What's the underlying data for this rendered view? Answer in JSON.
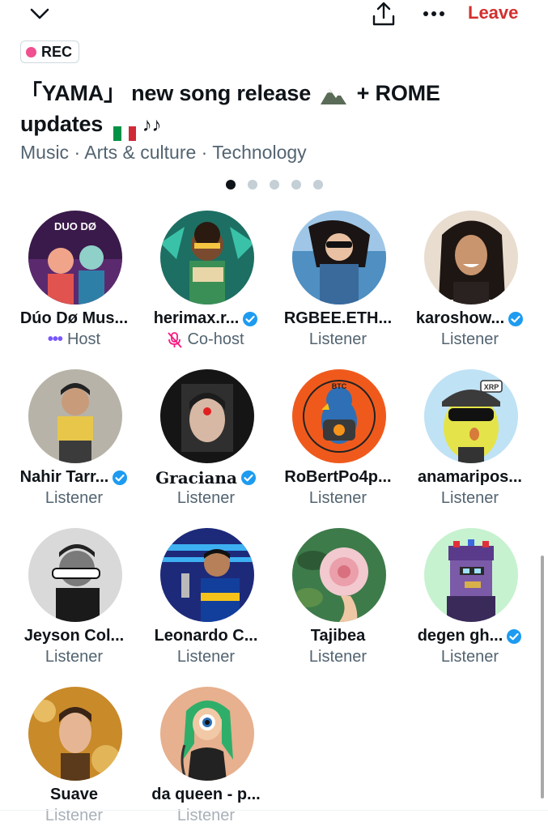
{
  "topbar": {
    "collapse_icon": "chevron-down-icon",
    "share_icon": "share-icon",
    "more_icon": "more-icon",
    "leave_label": "Leave",
    "leave_color": "#d32f2f"
  },
  "rec_label": "REC",
  "title": {
    "part1": "「YAMA」 new song release",
    "part2": "+ ROME",
    "part3": "updates",
    "notes": "♪♪"
  },
  "categories": "Music · Arts & culture · Technology",
  "carousel": {
    "count": 5,
    "active": 0
  },
  "participants": [
    {
      "name": "Dúo Dø Mus...",
      "role": "Host",
      "verified": false,
      "role_icon": "waveform-icon"
    },
    {
      "name": "herimax.r...",
      "role": "Co-host",
      "verified": true,
      "role_icon": "mic-muted-icon"
    },
    {
      "name": "RGBEE.ETH...",
      "role": "Listener",
      "verified": false
    },
    {
      "name": "karoshow...",
      "role": "Listener",
      "verified": true
    },
    {
      "name": "Nahir Tarr...",
      "role": "Listener",
      "verified": true
    },
    {
      "name": "Graciana",
      "role": "Listener",
      "verified": true
    },
    {
      "name": "RoBertPo4p...",
      "role": "Listener",
      "verified": false
    },
    {
      "name": "anamaripos...",
      "role": "Listener",
      "verified": false
    },
    {
      "name": "Jeyson Col...",
      "role": "Listener",
      "verified": false
    },
    {
      "name": "Leonardo C...",
      "role": "Listener",
      "verified": false
    },
    {
      "name": "Tajibea",
      "role": "Listener",
      "verified": false
    },
    {
      "name": "degen gh...",
      "role": "Listener",
      "verified": true
    },
    {
      "name": "Suave",
      "role": "Listener",
      "verified": false
    },
    {
      "name": "da queen - p...",
      "role": "Listener",
      "verified": false
    }
  ],
  "avatar_text": {
    "duo": "DUO DØ",
    "btc": "BTC",
    "xrp": "XRP"
  }
}
